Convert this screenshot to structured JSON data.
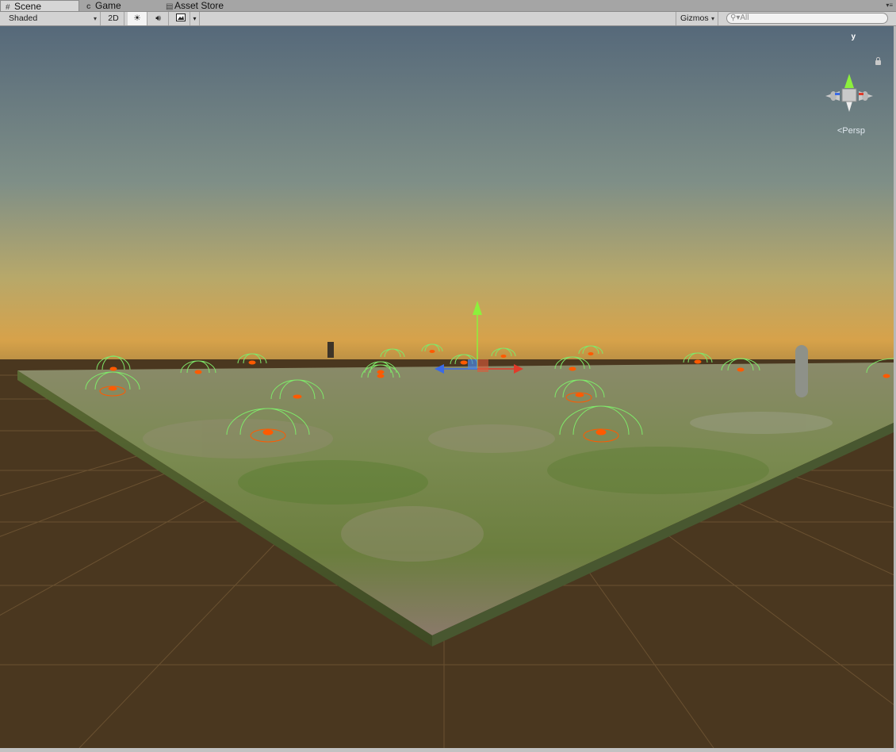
{
  "tabs": [
    {
      "label": "Scene",
      "icon": "grid-icon",
      "active": true
    },
    {
      "label": "Game",
      "icon": "pacman-icon",
      "active": false
    },
    {
      "label": "Asset Store",
      "icon": "bag-icon",
      "active": false
    }
  ],
  "toolbar": {
    "shading_mode": "Shaded",
    "mode_2d": "2D",
    "lighting_icon": "sun-icon",
    "audio_icon": "speaker-icon",
    "effects_icon": "image-icon",
    "gizmos": "Gizmos",
    "search_placeholder": "All"
  },
  "scene_gizmo": {
    "axis_label": "y",
    "projection": "Persp"
  },
  "colors": {
    "sky_top": "#5a6c77",
    "horizon": "#d7a24a",
    "ground": "#4a371f",
    "terrain": "#6a7a45",
    "sphere_gizmo": "#7fe86a",
    "light_marker": "#ff5a00",
    "axis_y": "#8cf03c",
    "axis_x": "#e03a2a",
    "axis_z": "#3a6ae6"
  }
}
